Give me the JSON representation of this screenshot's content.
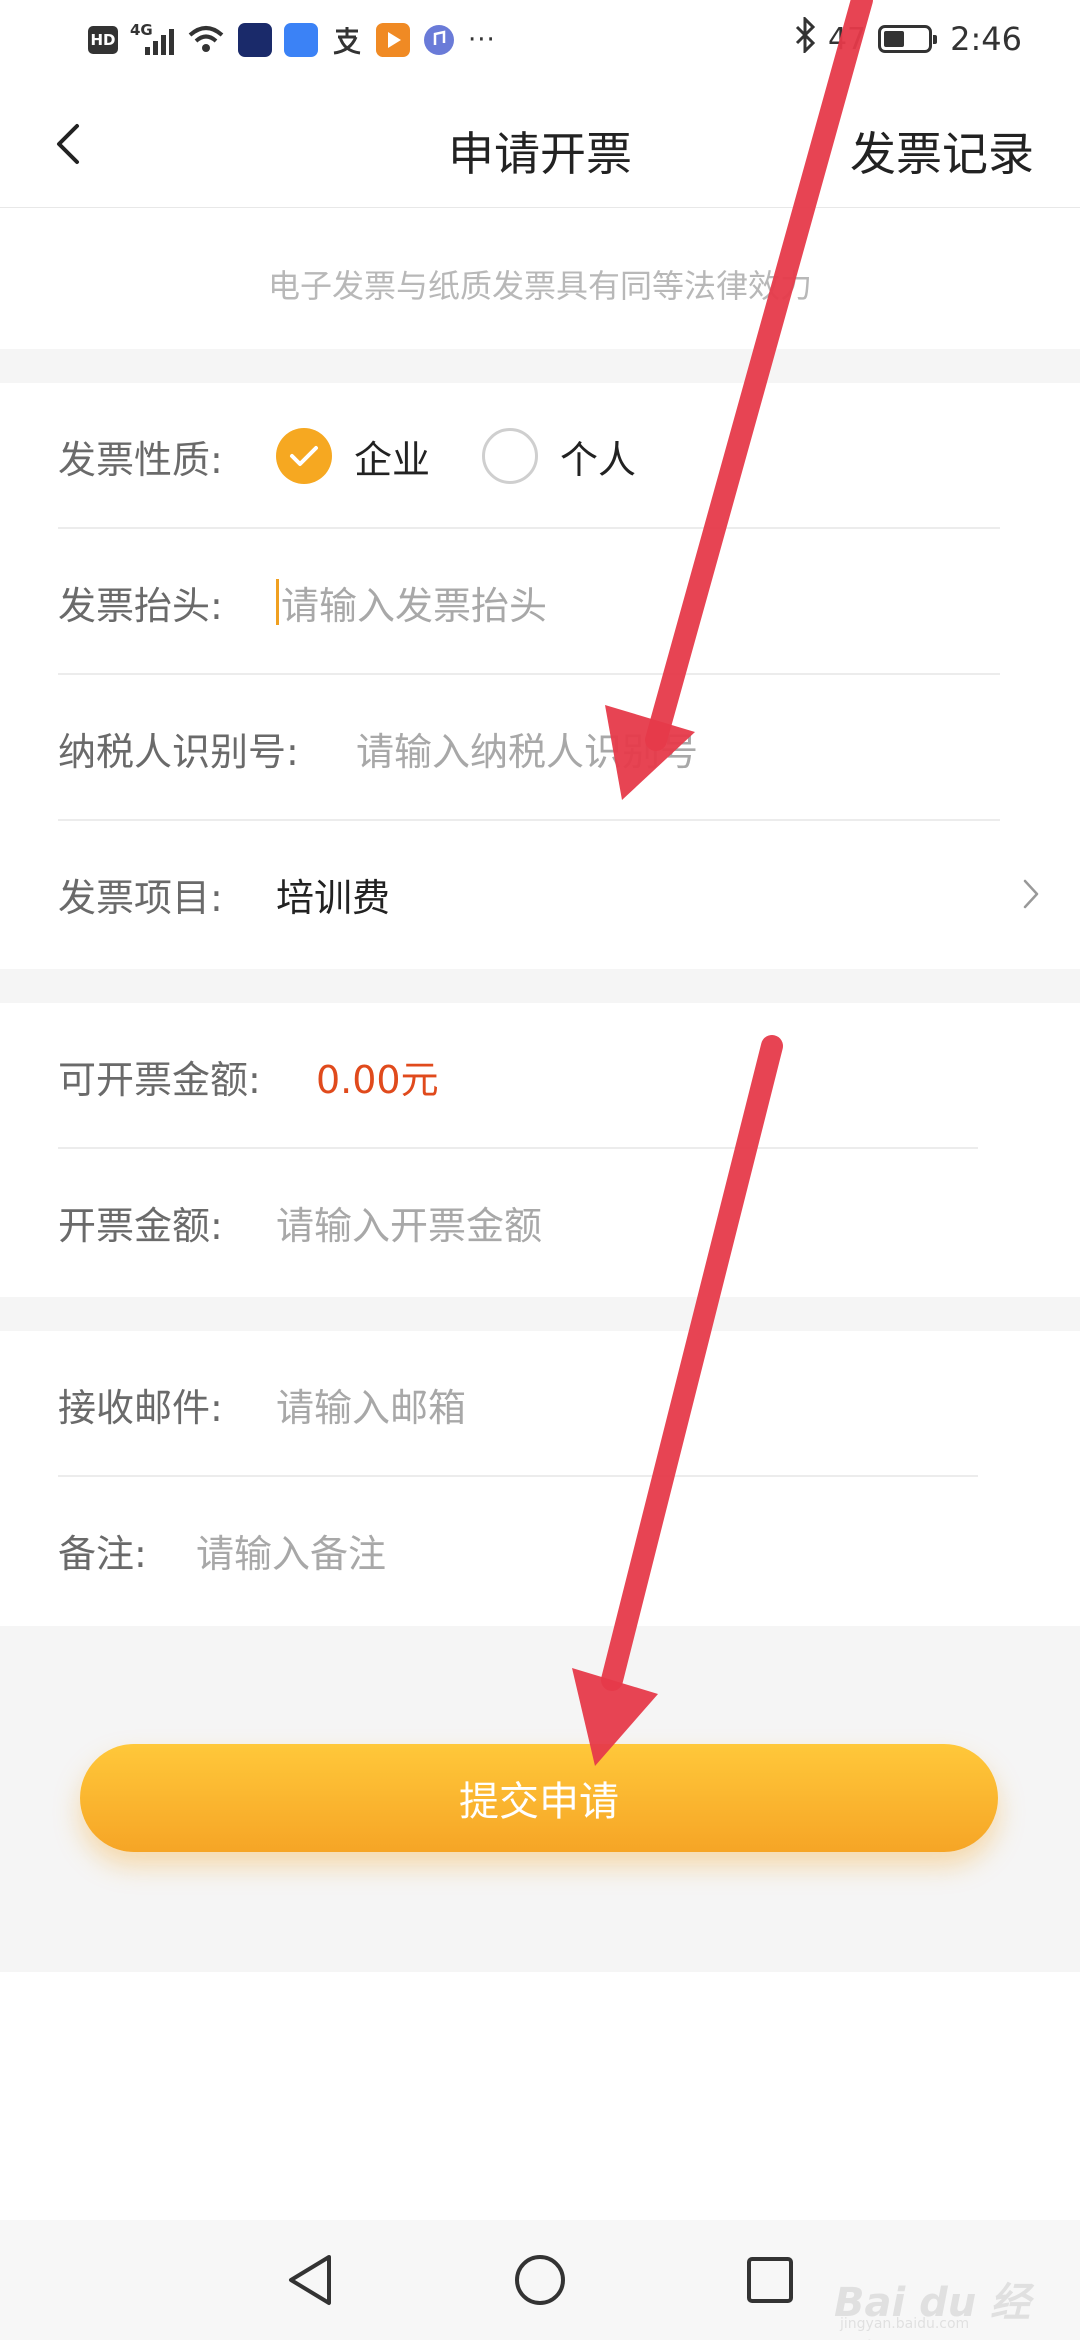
{
  "status_bar": {
    "left_badge": "HD",
    "network": "4G",
    "more": "···",
    "battery_percent": "47",
    "battery_level": 0.47,
    "time": "2:46"
  },
  "header": {
    "title": "申请开票",
    "right_action": "发票记录",
    "back_icon": "chevron-left-icon"
  },
  "notice": "电子发票与纸质发票具有同等法律效力",
  "invoice": {
    "type_label": "发票性质:",
    "type_options": [
      {
        "label": "企业",
        "selected": true
      },
      {
        "label": "个人",
        "selected": false
      }
    ],
    "title_label": "发票抬头:",
    "title_placeholder": "请输入发票抬头",
    "tax_id_label": "纳税人识别号:",
    "tax_id_placeholder": "请输入纳税人识别号",
    "item_label": "发票项目:",
    "item_value": "培训费"
  },
  "amount": {
    "available_label": "可开票金额:",
    "available_value": "0.00元",
    "amount_label": "开票金额:",
    "amount_placeholder": "请输入开票金额"
  },
  "contact": {
    "email_label": "接收邮件:",
    "email_placeholder": "请输入邮箱",
    "remark_label": "备注:",
    "remark_placeholder": "请输入备注"
  },
  "submit_label": "提交申请",
  "colors": {
    "accent": "#f6a821",
    "amount": "#e04a1c",
    "arrow": "#e63a4a"
  },
  "watermark": {
    "brand": "Bai du 经验",
    "site": "jingyan.baidu.com"
  }
}
